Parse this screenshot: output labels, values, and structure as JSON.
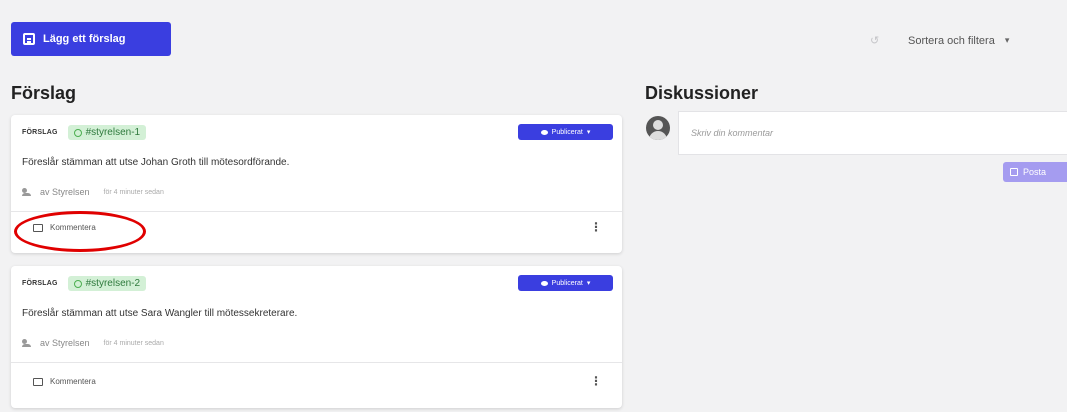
{
  "toolbar": {
    "add_proposal_label": "Lägg ett förslag",
    "sort_filter_label": "Sortera och filtera"
  },
  "proposals_section": {
    "title": "Förslag"
  },
  "discussion_section": {
    "title": "Diskussioner",
    "comment_placeholder": "Skriv din kommentar",
    "post_label": "Posta"
  },
  "proposals": [
    {
      "type": "FÖRSLAG",
      "tag": "#styrelsen-1",
      "status": "Publicerat",
      "text": "Föreslår stämman att utse Johan Groth till mötesordförande.",
      "author": "av Styrelsen",
      "time": "för 4 minuter sedan",
      "comment_label": "Kommentera"
    },
    {
      "type": "FÖRSLAG",
      "tag": "#styrelsen-2",
      "status": "Publicerat",
      "text": "Föreslår stämman att utse Sara Wangler till mötessekreterare.",
      "author": "av Styrelsen",
      "time": "för 4 minuter sedan",
      "comment_label": "Kommentera"
    }
  ],
  "colors": {
    "primary": "#3a3ee0",
    "tag_bg": "#d3f0d6",
    "highlight": "#e00000"
  },
  "icons": [
    "proposal-icon",
    "undo-icon",
    "chevron-down-icon",
    "tag-icon",
    "eye-icon",
    "group-icon",
    "comment-icon",
    "more-icon",
    "avatar-icon",
    "post-icon"
  ]
}
